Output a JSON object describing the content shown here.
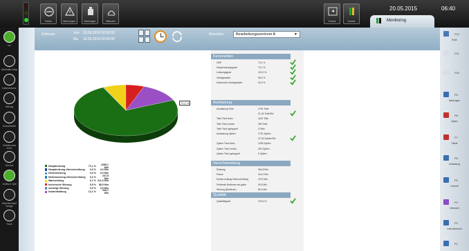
{
  "toolbar": {
    "buttons": [
      {
        "label": "Fehler",
        "icon": "error-circle-icon"
      },
      {
        "label": "Warnungen",
        "icon": "warning-icon"
      },
      {
        "label": "Wartungen",
        "icon": "maintenance-icon"
      },
      {
        "label": "Wäscher",
        "icon": "washer-icon"
      }
    ],
    "right_buttons": [
      {
        "label": "Zurück",
        "icon": "back-icon"
      },
      {
        "label": "Zurück",
        "icon": "panel-icon"
      }
    ],
    "date": "20.05.2015",
    "time": "06:40",
    "tab": "Monitoring"
  },
  "left_nav": [
    {
      "label": "ein",
      "icon": "power-on-icon"
    },
    {
      "label": "Abschalte setup",
      "icon": "person-icon"
    },
    {
      "label": "Kettenbremse",
      "icon": "brake-icon"
    },
    {
      "label": "Störung",
      "icon": "fault-icon"
    },
    {
      "label": "Einzelbetrieb",
      "icon": "arrow-icon"
    },
    {
      "label": "Schrittmodus eines",
      "icon": "step-icon"
    },
    {
      "label": "Not Aus",
      "icon": "emergency-icon"
    },
    {
      "label": "Greifsch. Spill",
      "icon": "gripper-icon"
    },
    {
      "label": "Maschinenlauf Anlage",
      "icon": "machine-icon"
    },
    {
      "label": "Touch",
      "icon": "touch-icon"
    }
  ],
  "filter": {
    "zeitraum_label": "Zeitraum",
    "von_label": "Von",
    "von_value": "15.06.2019 00:00:00",
    "bis_label": "Bis",
    "bis_value": "19.06.2019 00:00:00",
    "maschine_label": "Maschine",
    "maschine_value": "Bearbeitungszentrum A"
  },
  "chart_data": {
    "type": "pie",
    "categories": [
      "Hauptnutzung",
      "Hauptnutzung Überschreibung",
      "Nebennutzung",
      "Nebennutzung Überschreibung",
      "Wartezeitung",
      "technische Störung",
      "sonstige Störung",
      "Instandhaltung"
    ],
    "values": [
      71.1,
      0.0,
      0.0,
      0.2,
      6.7,
      5.5,
      0.0,
      12.1
    ],
    "hours": [
      "2285,1 Min",
      "0,0 Min",
      "0,0 Min",
      "247,8 Min",
      "211,3 Min",
      "85,5 Min",
      "0,0 Min",
      "346,1 Min"
    ],
    "percent_labels": [
      "71,1 %",
      "0,0 %",
      "0,0 %",
      "0,2 %",
      "6,7 %",
      "5,5 %",
      "0,0 %",
      "12,1 %"
    ],
    "colors": [
      "#1a6e14",
      "#1f3f9e",
      "#3a9ad9",
      "#2a7fb8",
      "#f0d21a",
      "#d62020",
      "#6b8ab8",
      "#9b4fc4"
    ],
    "slice_label": "71,1 %"
  },
  "kennzahlen": {
    "title": "Kennzahlen",
    "rows": [
      {
        "k": "OEE",
        "v": "73,1 %"
      },
      {
        "k": "Hauptnutzungsgrad",
        "v": "73,1 %"
      },
      {
        "k": "Leistungsgrad",
        "v": "100,0 %"
      },
      {
        "k": "Verfügbarkeit",
        "v": "98,0 %"
      },
      {
        "k": "technische Verfügbarkeit",
        "v": "94,5 %"
      }
    ]
  },
  "auslastung": {
    "title": "Auslastung",
    "rows": [
      {
        "k": "Auslastung Teile",
        "v": "1791 Teile"
      },
      {
        "k": "",
        "v": "21,04 Teile/Std"
      },
      {
        "k": "Teile Tisch links",
        "v": "1100 Teile"
      },
      {
        "k": "Teile Tisch rechts",
        "v": "282 Teile"
      },
      {
        "k": "Teile Tisch getoppelt",
        "v": "0 Teile"
      },
      {
        "k": "Auslastung Zyklen",
        "v": "1791 Zyklen"
      },
      {
        "k": "",
        "v": "21,04 Zyklen/Std"
      },
      {
        "k": "Zyklen Tisch links",
        "v": "1499 Zyklen"
      },
      {
        "k": "Zyklen Tisch rechts",
        "v": "282 Zyklen"
      },
      {
        "k": "Zyklen Tisch getoppelt",
        "v": "0 Zyklen"
      }
    ]
  },
  "verschwendung": {
    "title": "Verschwendung",
    "rows": [
      {
        "k": "Rüstung",
        "v": "364,5 Min"
      },
      {
        "k": "Pause",
        "v": "114,0 Min"
      },
      {
        "k": "Kosten Auftrag Überschreitung",
        "v": "1072 Min"
      },
      {
        "k": "Fehlende Bediener-ein-gabe",
        "v": "90,5 Min"
      },
      {
        "k": "Störung (Bediener)",
        "v": "85,0 Min"
      }
    ]
  },
  "qualitaet": {
    "title": "Qualität",
    "rows": [
      {
        "k": "Qualitätsgrad",
        "v": "100,0 %"
      }
    ]
  },
  "right_nav": [
    {
      "fkey": "F12",
      "label": "Ende",
      "icon": "gear-icon",
      "color": "#4a7ab5"
    },
    {
      "fkey": "F11",
      "label": "",
      "icon": "blank-icon",
      "color": "#d8dee4"
    },
    {
      "fkey": "F10",
      "label": "",
      "icon": "blank-icon",
      "color": "#d8dee4"
    },
    {
      "fkey": "F9",
      "label": "Meldungen",
      "icon": "messages-icon",
      "color": "#3a6fb0"
    },
    {
      "fkey": "F8",
      "label": "Zyklen",
      "icon": "cycles-icon",
      "color": "#c23030"
    },
    {
      "fkey": "F7",
      "label": "Plaste",
      "icon": "plaste-icon",
      "color": "#c23030"
    },
    {
      "fkey": "F6",
      "label": "Auslastung",
      "icon": "usage-icon",
      "color": "#3a6fb0"
    },
    {
      "fkey": "F5",
      "label": "Intervall",
      "icon": "interval-icon",
      "color": "#3a6fb0"
    },
    {
      "fkey": "F4",
      "label": "Übersicht",
      "icon": "overview-icon",
      "color": "#8a4ac4"
    },
    {
      "fkey": "F3",
      "label": "Linienübersicht",
      "icon": "lines-icon",
      "color": "#3a6fb0"
    },
    {
      "fkey": "F2",
      "label": "",
      "icon": "doc-icon",
      "color": "#3a6fb0"
    }
  ]
}
